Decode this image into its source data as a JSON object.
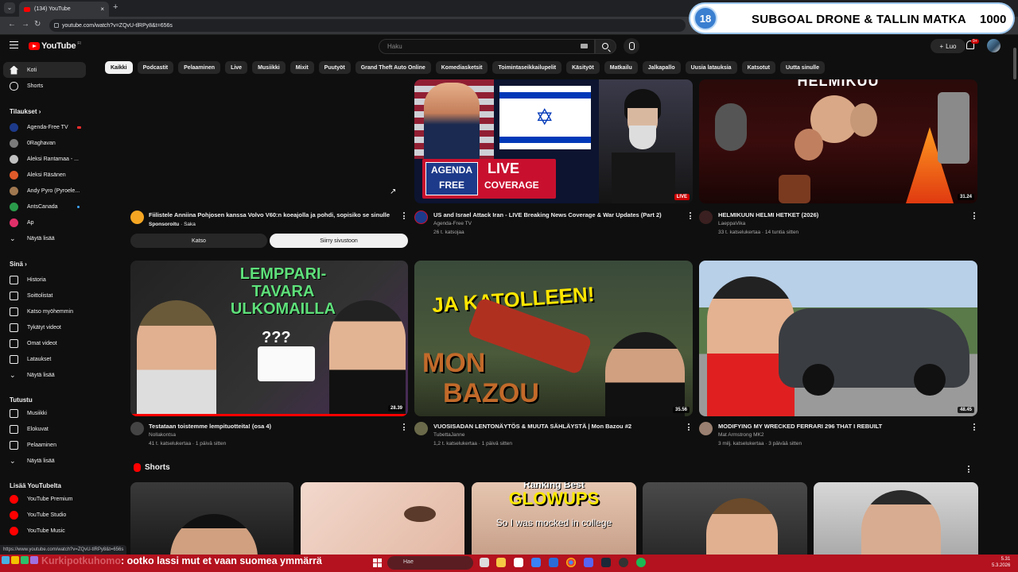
{
  "browser": {
    "tab_title": "(134) YouTube",
    "tab_close": "×",
    "new_tab": "+",
    "tab_menu": "⌄",
    "back": "←",
    "forward": "→",
    "reload": "↻",
    "url": "youtube.com/watch?v=ZQvU-tlRPy8&t=656s",
    "status_url": "https://www.youtube.com/watch?v=ZQvU-tlRPy8&t=656s"
  },
  "stream_overlay": {
    "goal_number": "18",
    "goal_text": "SUBGOAL DRONE & TALLIN MATKA",
    "goal_count": "1000"
  },
  "header": {
    "logo": "YouTube",
    "logo_region": "FI",
    "search_placeholder": "Haku",
    "create_label": "Luo",
    "notification_count": "9+"
  },
  "chips": [
    "Kaikki",
    "Podcastit",
    "Pelaaminen",
    "Live",
    "Musiikki",
    "Mixit",
    "Puutyöt",
    "Grand Theft Auto Online",
    "Komediasketsit",
    "Toimintaseikkailupelit",
    "Käsityöt",
    "Matkailu",
    "Jalkapallo",
    "Uusia latauksia",
    "Katsotut",
    "Uutta sinulle"
  ],
  "sidebar": {
    "home": "Koti",
    "shorts": "Shorts",
    "subscriptions_head": "Tilaukset",
    "subscriptions": [
      {
        "name": "Agenda-Free TV",
        "color": "#1d3a8a"
      },
      {
        "name": "0Raghavan",
        "color": "#7a7a7a"
      },
      {
        "name": "Aleksi Rantamaa - ...",
        "color": "#c0c0c0"
      },
      {
        "name": "Aleksi Räsänen",
        "color": "#e05a2a"
      },
      {
        "name": "Andy Pyro (Pyroele...",
        "color": "#a07850"
      },
      {
        "name": "AntsCanada",
        "color": "#2a9a4a"
      },
      {
        "name": "Ap",
        "color": "#e0306a"
      }
    ],
    "show_more": "Näytä lisää",
    "you_head": "Sinä",
    "you_items": [
      "Historia",
      "Soittolistat",
      "Katso myöhemmin",
      "Tykätyt videot",
      "Omat videot",
      "Lataukset",
      "Näytä lisää"
    ],
    "explore_head": "Tutustu",
    "explore_items": [
      "Musiikki",
      "Elokuvat",
      "Pelaaminen",
      "Näytä lisää"
    ],
    "more_head": "Lisää YouTubelta",
    "more_items": [
      "YouTube Premium",
      "YouTube Studio",
      "YouTube Music"
    ]
  },
  "ad": {
    "title": "Fiilistele Anniina Pohjosen kanssa Volvo V60:n koeajolla ja pohdi, sopisiko se sinulle",
    "sponsored": "Sponsoroitu",
    "advertiser": "Saka",
    "btn_watch": "Katso",
    "btn_visit": "Siirry sivustoon"
  },
  "videos_row1": [
    {
      "title": "US and Israel Attack Iran - LIVE Breaking News Coverage & War Updates (Part 2)",
      "channel": "Agenda-Free TV",
      "meta": "26 t. katsojaa",
      "badge": "LIVE",
      "thumb_text_1": "AGENDA FREE",
      "thumb_text_2": "LIVE",
      "thumb_text_3": "COVERAGE"
    },
    {
      "title": "HELMIKUUN HELMI HETKET (2026)",
      "channel": "LaeppaVika",
      "meta": "33 t. katselukertaa · 14 tuntia sitten",
      "duration": "31.24",
      "thumb_text": "HELMIKUU"
    }
  ],
  "videos_row2": [
    {
      "title": "Testataan toistemme lempituotteita! (osa 4)",
      "channel": "Nollakontsa",
      "meta": "41 t. katselukertaa · 1 päivä sitten",
      "duration": "28.39",
      "thumb_text": "LEMPPARI-TAVARA ULKOMAILLA",
      "thumb_q": "???"
    },
    {
      "title": "VUOSISADAN LENTONÄYTÖS & MUUTA SÄHLÄYSTÄ | Mon Bazou #2",
      "channel": "TubettaJanne",
      "meta": "1,2 t. katselukertaa · 1 päivä sitten",
      "duration": "35.56",
      "thumb_text_1": "JA KATOLLEEN!",
      "thumb_text_2": "MON",
      "thumb_text_3": "BAZOU"
    },
    {
      "title": "MODIFYING MY WRECKED FERRARI 296 THAT I REBUILT",
      "channel": "Mat Armstrong MK2",
      "meta": "3 milj. katselukertaa · 3 päivää sitten",
      "duration": "48.45"
    }
  ],
  "shorts": {
    "head": "Shorts",
    "short3_line1": "Ranking Best",
    "short3_line2": "GLOWUPS",
    "short3_line3": "So I was mocked in college"
  },
  "taskbar": {
    "chat_nick": "Kurkipotkuhomo",
    "chat_msg": ": ootko lassi mut et vaan suomea ymmärrä",
    "search_label": "Hae",
    "time": "5.31",
    "date": "5.3.2026"
  }
}
